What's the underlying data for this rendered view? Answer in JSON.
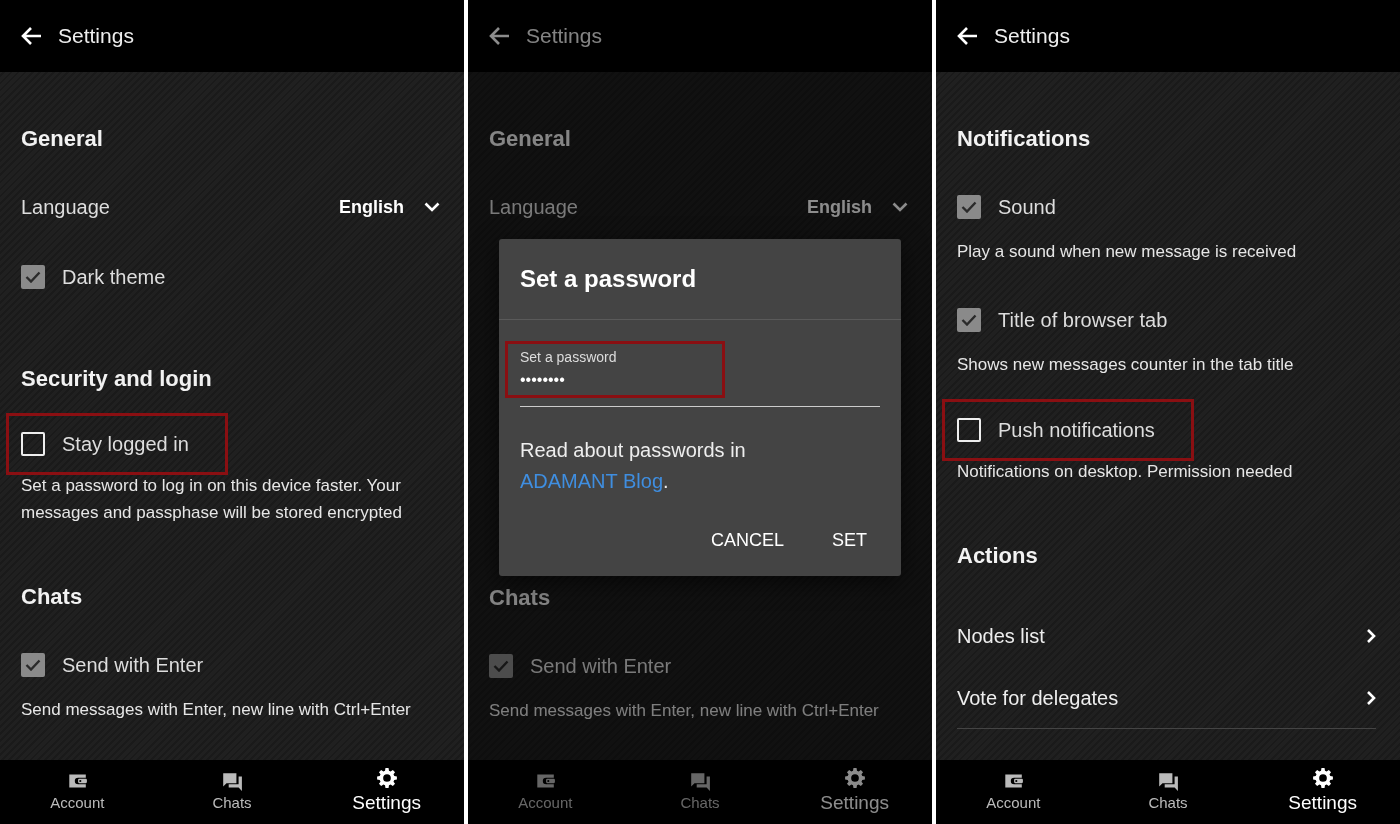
{
  "panels": [
    {
      "header": {
        "title": "Settings"
      },
      "items": [
        {
          "kind": "section",
          "text": "General"
        },
        {
          "kind": "select",
          "label": "Language",
          "value": "English"
        },
        {
          "kind": "checkbox",
          "label": "Dark theme",
          "checked": true,
          "highlighted": false
        },
        {
          "kind": "section",
          "text": "Security and login"
        },
        {
          "kind": "checkbox",
          "label": "Stay logged in",
          "checked": false,
          "highlighted": true
        },
        {
          "kind": "description",
          "text": "Set a password to log in on this device faster. Your messages and passphase will be stored encrypted"
        },
        {
          "kind": "section",
          "text": "Chats"
        },
        {
          "kind": "checkbox",
          "label": "Send with Enter",
          "checked": true,
          "highlighted": false
        },
        {
          "kind": "description",
          "text": "Send messages with Enter, new line with Ctrl+Enter"
        }
      ],
      "nav": [
        {
          "kind": "account",
          "label": "Account",
          "selected": false
        },
        {
          "kind": "chats",
          "label": "Chats",
          "selected": false
        },
        {
          "kind": "settings",
          "label": "Settings",
          "selected": true
        }
      ]
    },
    {
      "header": {
        "title": "Settings"
      },
      "dimmed": true,
      "items": [
        {
          "kind": "section",
          "text": "General"
        },
        {
          "kind": "select",
          "label": "Language",
          "value": "English"
        },
        {
          "kind": "section",
          "text": "Chats"
        },
        {
          "kind": "checkbox",
          "label": "Send with Enter",
          "checked": true,
          "highlighted": false
        },
        {
          "kind": "description",
          "text": "Send messages with Enter, new line with Ctrl+Enter"
        }
      ],
      "dialog": {
        "title": "Set a password",
        "field": {
          "label": "Set a password",
          "value": "••••••••",
          "highlighted": true
        },
        "help": {
          "text_before": "Read about passwords in ",
          "link": "ADAMANT Blog",
          "text_after": "."
        },
        "buttons": [
          "CANCEL",
          "SET"
        ]
      },
      "nav": [
        {
          "kind": "account",
          "label": "Account",
          "selected": false
        },
        {
          "kind": "chats",
          "label": "Chats",
          "selected": false
        },
        {
          "kind": "settings",
          "label": "Settings",
          "selected": true
        }
      ]
    },
    {
      "header": {
        "title": "Settings"
      },
      "items": [
        {
          "kind": "section",
          "text": "Notifications"
        },
        {
          "kind": "checkbox",
          "label": "Sound",
          "checked": true,
          "highlighted": false
        },
        {
          "kind": "description",
          "text": "Play a sound when new message is received"
        },
        {
          "kind": "checkbox",
          "label": "Title of browser tab",
          "checked": true,
          "highlighted": false
        },
        {
          "kind": "description",
          "text": "Shows new messages counter in the tab title"
        },
        {
          "kind": "checkbox",
          "label": "Push notifications",
          "checked": false,
          "highlighted": true
        },
        {
          "kind": "description",
          "text": "Notifications on desktop. Permission needed"
        },
        {
          "kind": "section",
          "text": "Actions"
        },
        {
          "kind": "link",
          "label": "Nodes list"
        },
        {
          "kind": "link",
          "label": "Vote for delegates"
        }
      ],
      "nav": [
        {
          "kind": "account",
          "label": "Account",
          "selected": false
        },
        {
          "kind": "chats",
          "label": "Chats",
          "selected": false
        },
        {
          "kind": "settings",
          "label": "Settings",
          "selected": true
        }
      ]
    }
  ]
}
